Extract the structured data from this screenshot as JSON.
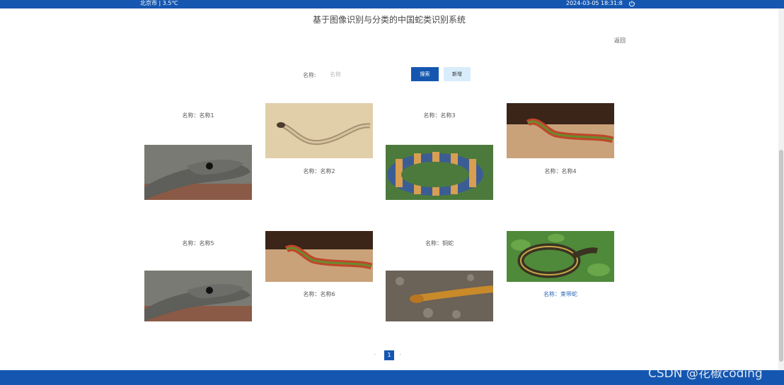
{
  "header": {
    "weather": "北京市 | 3.5℃",
    "datetime": "2024-03-05   18:31:8",
    "title": "基于图像识别与分类的中国蛇类识别系统",
    "back": "返回"
  },
  "search": {
    "label": "名称:",
    "placeholder": "名称",
    "search_button": "搜索",
    "add_button": "新增"
  },
  "cards": [
    {
      "label": "名称：名称1",
      "image": "black-mamba"
    },
    {
      "label": "名称：名称2",
      "image": "sand-snake"
    },
    {
      "label": "名称：名称3",
      "image": "banded-krait"
    },
    {
      "label": "名称：名称4",
      "image": "red-snake"
    },
    {
      "label": "名称：名称5",
      "image": "black-mamba"
    },
    {
      "label": "名称：名称6",
      "image": "red-snake"
    },
    {
      "label": "名称：铜蛇",
      "image": "copper-snake"
    },
    {
      "label": "名称：束带蛇",
      "image": "garter-snake"
    }
  ],
  "pagination": {
    "prev": "‹",
    "current": "1",
    "next": "›"
  },
  "watermark": "CSDN @花椒coding",
  "colors": {
    "primary": "#1557b0",
    "light": "#d9ecfb"
  }
}
